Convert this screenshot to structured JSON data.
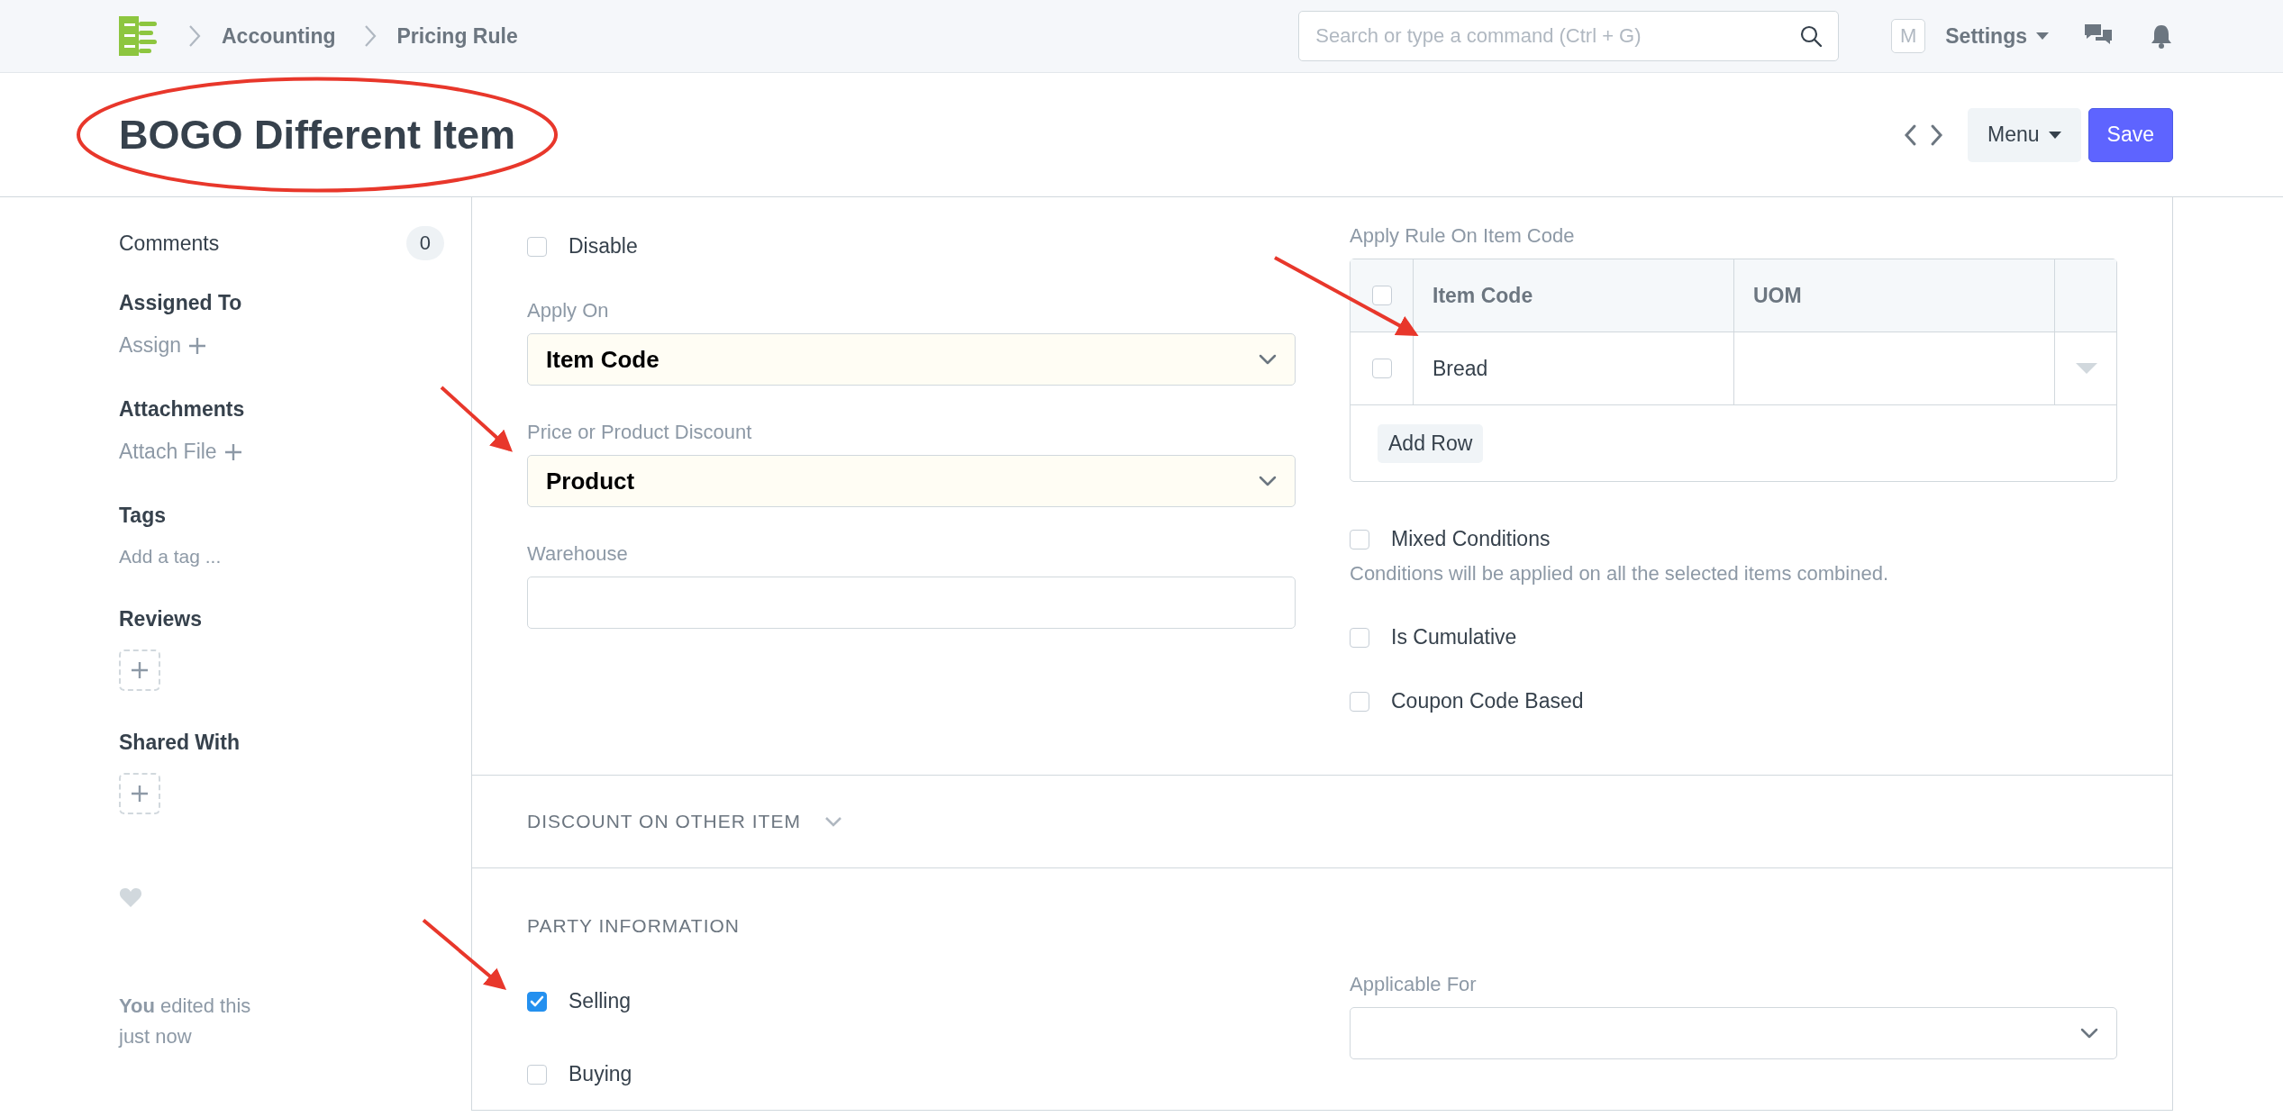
{
  "navbar": {
    "breadcrumbs": [
      "Accounting",
      "Pricing Rule"
    ],
    "search": {
      "placeholder": "Search or type a command (Ctrl + G)"
    },
    "avatar": "M",
    "settings": "Settings"
  },
  "page": {
    "title": "BOGO Different Item",
    "circled": true,
    "menu_button": "Menu",
    "save_button": "Save"
  },
  "sidebar": {
    "comments": {
      "label": "Comments",
      "count": "0"
    },
    "sections": [
      {
        "heading": "Assigned To",
        "kind": "action",
        "action": "Assign"
      },
      {
        "heading": "Attachments",
        "kind": "action",
        "action": "Attach File"
      },
      {
        "heading": "Tags",
        "kind": "tag",
        "action": "Add a tag ..."
      },
      {
        "heading": "Reviews",
        "kind": "add_box"
      },
      {
        "heading": "Shared With",
        "kind": "add_box"
      }
    ],
    "edited": "**You** edited this just now"
  },
  "main_section": {
    "left": [
      {
        "kind": "checkbox",
        "label": "Disable",
        "checked": false
      },
      {
        "kind": "select",
        "label": "Apply On",
        "value": "Item Code"
      },
      {
        "kind": "select",
        "label": "Price or Product Discount",
        "value": "Product",
        "arrowed": true
      },
      {
        "kind": "input",
        "label": "Warehouse"
      }
    ],
    "right": [
      {
        "kind": "table",
        "label": "Apply Rule On Item Code",
        "columns": [
          "Item Code",
          "UOM"
        ],
        "all_selected": false,
        "rows": [
          {
            "item_code": "Bread",
            "selected": false,
            "arrowed": true
          }
        ],
        "add_row": "Add Row"
      },
      {
        "kind": "checkbox",
        "label": "Mixed Conditions",
        "checked": false,
        "description": "Conditions will be applied on all the selected items combined."
      },
      {
        "kind": "checkbox",
        "label": "Is Cumulative",
        "checked": false
      },
      {
        "kind": "checkbox",
        "label": "Coupon Code Based",
        "checked": false
      }
    ]
  },
  "discount_section": {
    "title": "DISCOUNT ON OTHER ITEM",
    "expanded": false
  },
  "party_section": {
    "title": "PARTY INFORMATION",
    "left": [
      {
        "kind": "checkbox",
        "label": "Selling",
        "checked": true,
        "arrowed": true
      },
      {
        "kind": "checkbox",
        "label": "Buying",
        "checked": false
      }
    ],
    "right": [
      {
        "kind": "select",
        "label": "Applicable For"
      }
    ]
  }
}
